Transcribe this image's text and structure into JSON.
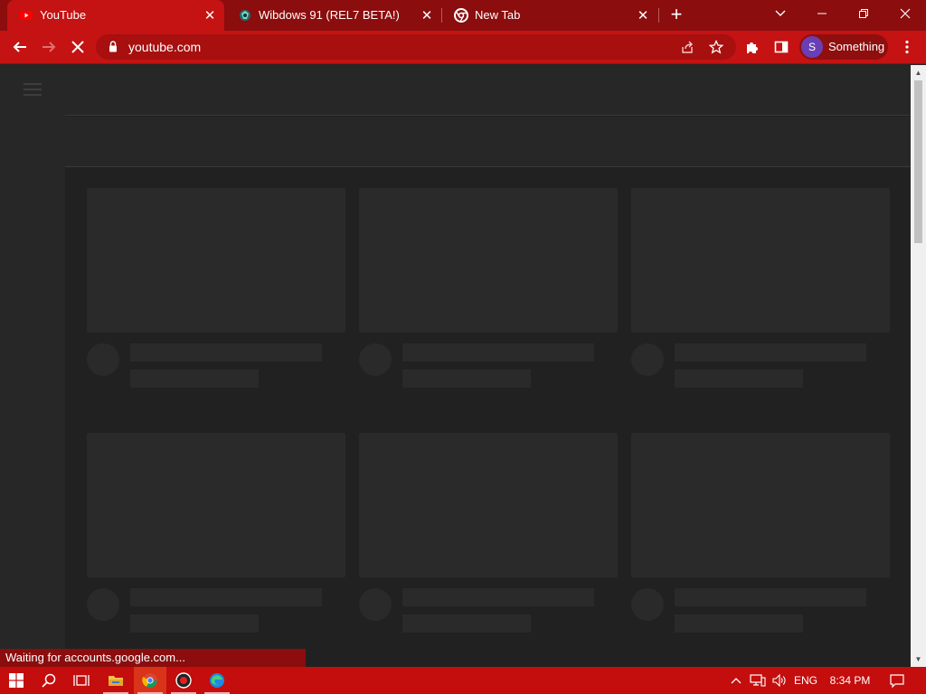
{
  "browser": {
    "tabs": [
      {
        "title": "YouTube",
        "favicon": "youtube-icon",
        "active": true
      },
      {
        "title": "Wibdows 91 (REL7 BETA!)",
        "favicon": "windows93-icon",
        "active": false
      },
      {
        "title": "New Tab",
        "favicon": "chrome-icon",
        "active": false
      }
    ],
    "new_tab_symbol": "+",
    "close_symbol": "✕",
    "window_controls": {
      "tab_search": "⌄",
      "minimize": "—",
      "restore": "❐",
      "close": "✕"
    },
    "omnibox": {
      "url": "youtube.com"
    },
    "profile": {
      "initial": "S",
      "name": "Something"
    },
    "theme_color": "#c51212"
  },
  "status_bar": {
    "text": "Waiting for accounts.google.com..."
  },
  "taskbar": {
    "language": "ENG",
    "time": "8:34 PM"
  }
}
